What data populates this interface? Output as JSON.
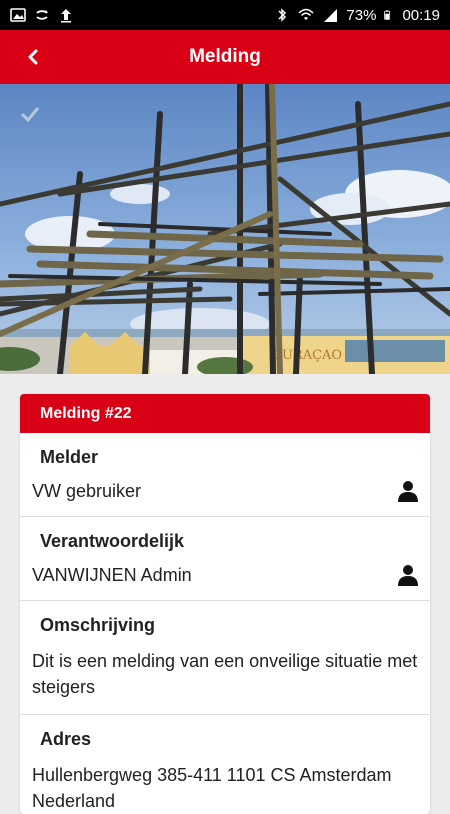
{
  "status": {
    "battery": "73%",
    "time": "00:19"
  },
  "appbar": {
    "title": "Melding"
  },
  "card": {
    "header": "Melding #22",
    "melder_label": "Melder",
    "melder_value": "VW gebruiker",
    "verantwoordelijk_label": "Verantwoordelijk",
    "verantwoordelijk_value": "VANWIJNEN Admin",
    "omschrijving_label": "Omschrijving",
    "omschrijving_value": "Dit is een melding van een onveilige situatie met steigers",
    "adres_label": "Adres",
    "adres_value": "Hullenbergweg 385-411 1101 CS Amsterdam Nederland"
  },
  "photo": {
    "sign_text": "CURAÇAO"
  },
  "colors": {
    "accent": "#d90016",
    "statusbar": "#000000"
  },
  "icons": [
    "image-icon",
    "sync-icon",
    "upload-icon",
    "bluetooth-icon",
    "wifi-icon",
    "signal-icon",
    "battery-icon",
    "back-arrow-icon",
    "person-icon"
  ]
}
